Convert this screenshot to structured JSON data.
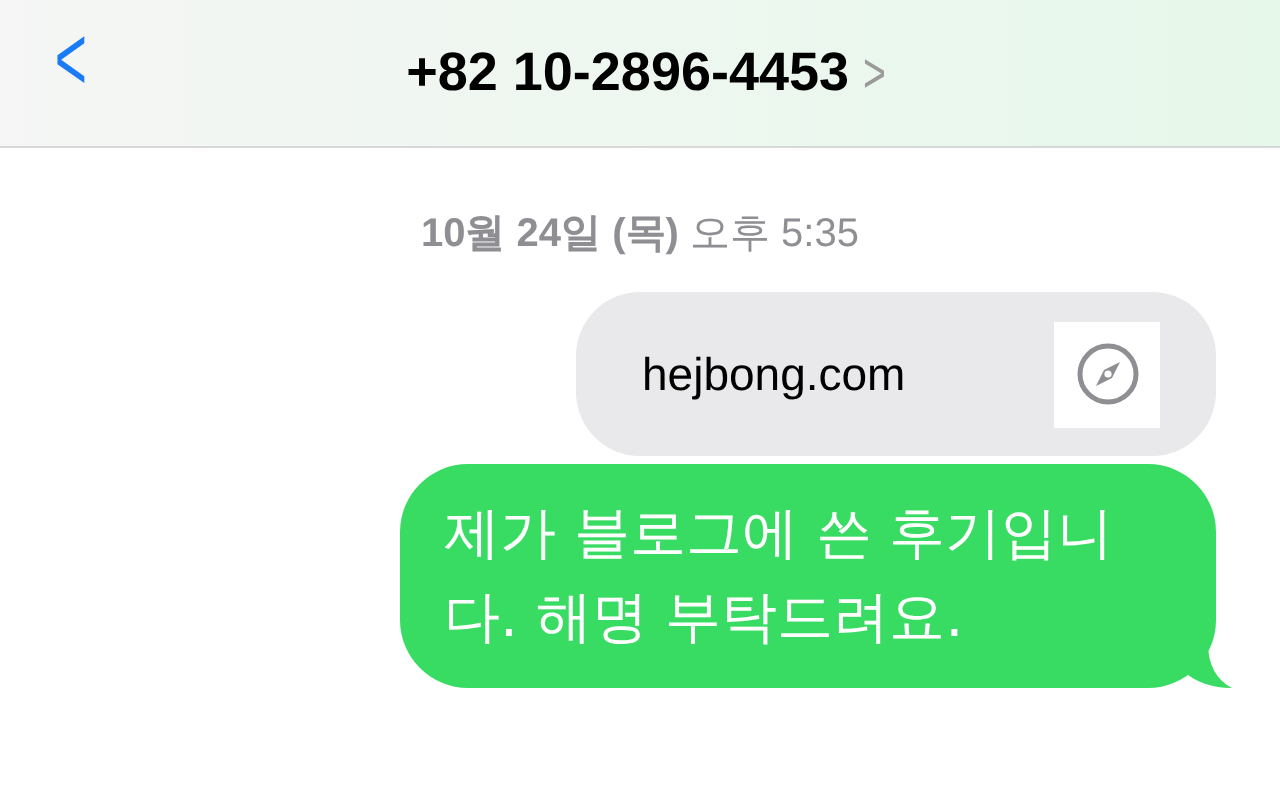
{
  "header": {
    "back": "<",
    "title": "+82 10-2896-4453",
    "chevron": ">"
  },
  "timestamp": "**10월 24일 (목)** 오후 5:35",
  "messages": [
    {
      "kind": "link",
      "text": "hejbong.com"
    },
    {
      "kind": "text",
      "text": "제가 블로그에 쓴 후기입니다. 해명 부탁드려요."
    }
  ]
}
